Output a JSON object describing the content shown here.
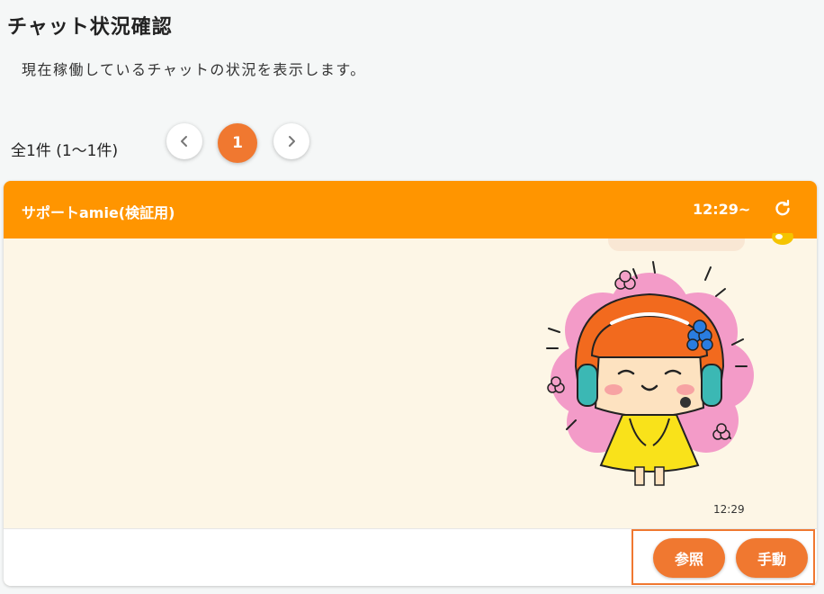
{
  "page": {
    "title": "チャット状況確認",
    "description": "現在稼働しているチャットの状況を表示します。"
  },
  "pagination": {
    "count_text": "全1件 (1〜1件)",
    "current_page": "1",
    "prev_icon": "chevron-left-icon",
    "next_icon": "chevron-right-icon"
  },
  "chat_card": {
    "title": "サポートamie(検証用)",
    "start_time": "12:29~",
    "refresh_icon": "refresh-icon",
    "header_color": "#ff9500",
    "message_time": "12:29",
    "sticker_icon": "girl-headset-sticker"
  },
  "actions": {
    "view_label": "参照",
    "manual_label": "手動",
    "button_color": "#f07830"
  }
}
